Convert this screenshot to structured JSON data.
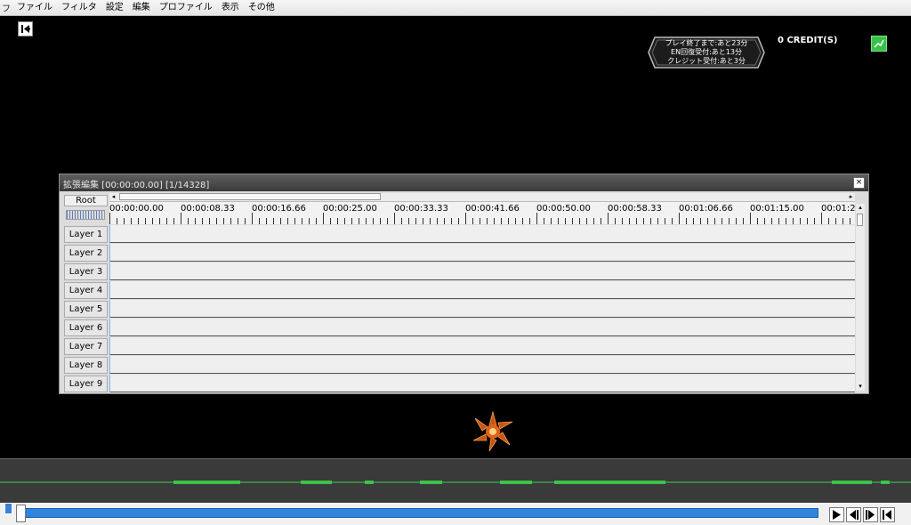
{
  "menubar": {
    "app_glyph": "フ",
    "items": [
      "ファイル",
      "フィルタ",
      "設定",
      "編集",
      "プロファイル",
      "表示",
      "その他"
    ]
  },
  "hud": {
    "lines": [
      "プレイ終了まで:あと23分",
      "EN回復受付:あと13分",
      "クレジット受付:あと3分"
    ],
    "credit": "0 CREDIT(S)"
  },
  "ext_window": {
    "title": "拡張編集 [00:00:00.00] [1/14328]",
    "close_label": "×",
    "root_label": "Root",
    "timecodes": [
      "00:00:00.00",
      "00:00:08.33",
      "00:00:16.66",
      "00:00:25.00",
      "00:00:33.33",
      "00:00:41.66",
      "00:00:50.00",
      "00:00:58.33",
      "00:01:06.66",
      "00:01:15.00",
      "00:01:2"
    ],
    "layers": [
      "Layer 1",
      "Layer 2",
      "Layer 3",
      "Layer 4",
      "Layer 5",
      "Layer 6",
      "Layer 7",
      "Layer 8",
      "Layer 9"
    ]
  },
  "icons": {
    "back": "back-to-start-icon",
    "status": "green-status-icon",
    "play": "play-icon",
    "prev_frame": "prev-frame-icon",
    "next_frame": "next-frame-icon",
    "to_start": "to-start-icon"
  },
  "colors": {
    "seek_accent": "#2f84e0",
    "audio_wave": "#3cd14b",
    "hud_green": "#39c24a"
  }
}
